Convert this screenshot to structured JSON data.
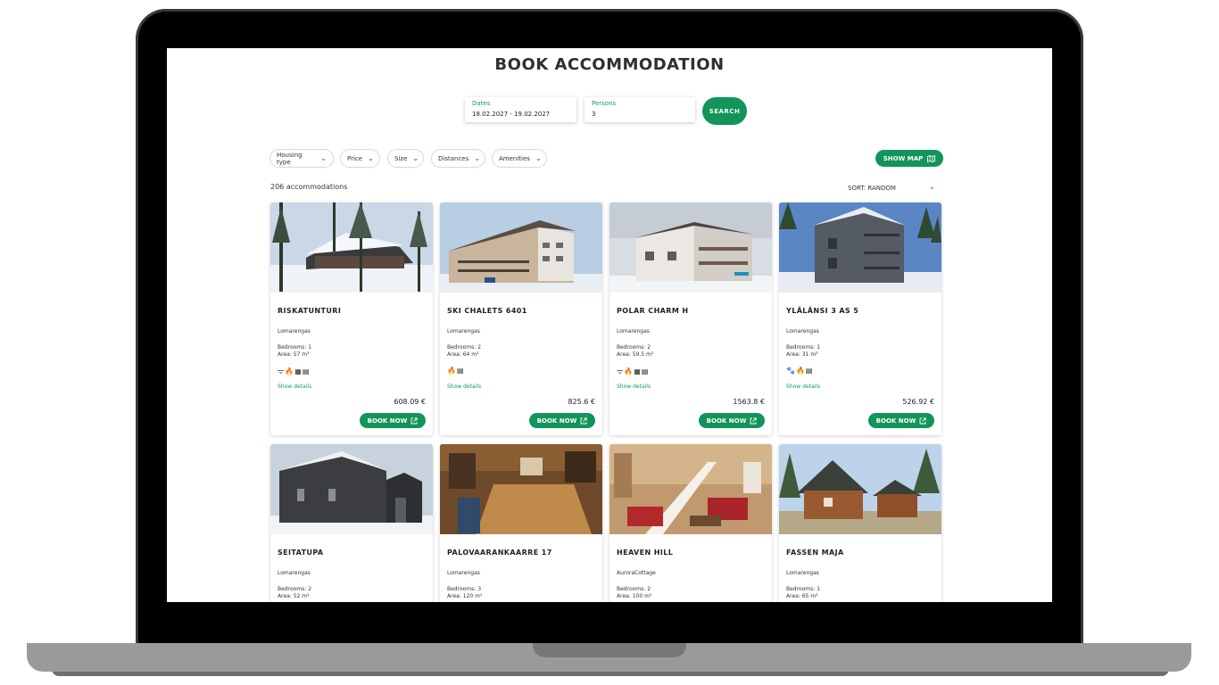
{
  "page": {
    "title": "BOOK ACCOMMODATION"
  },
  "search": {
    "dates_label": "Dates",
    "dates_value": "18.02.2027 - 19.02.2027",
    "persons_label": "Persons",
    "persons_value": "3",
    "search_button": "SEARCH"
  },
  "filters": [
    "Housing type",
    "Price",
    "Size",
    "Distances",
    "Amenities"
  ],
  "map_button": "SHOW MAP",
  "results": {
    "count_text": "206 accommodations",
    "sort_text": "SORT: RANDOM"
  },
  "colors": {
    "accent": "#12945a"
  },
  "cards": [
    {
      "name": "RISKATUNTURI",
      "location": "Lomarengas",
      "bedrooms": "Bedrooms: 1",
      "area": "Area: 57 m²",
      "amenities": "ᯤ🔥▦▤",
      "details": "Show details",
      "price": "608.09 €",
      "book": "BOOK NOW",
      "image": "snowy-cabin-forest"
    },
    {
      "name": "SKI CHALETS 6401",
      "location": "Lomarengas",
      "bedrooms": "Bedrooms: 2",
      "area": "Area: 64 m²",
      "amenities": "🔥▤",
      "details": "Show details",
      "price": "825.6 €",
      "book": "BOOK NOW",
      "image": "apartment-building-winter"
    },
    {
      "name": "POLAR CHARM H",
      "location": "Lomarengas",
      "bedrooms": "Bedrooms: 2",
      "area": "Area: 59.5 m²",
      "amenities": "ᯤ🔥▦▤",
      "details": "Show details",
      "price": "1563.8 €",
      "book": "BOOK NOW",
      "image": "balcony-building-snow"
    },
    {
      "name": "YLÄLÄNSI 3 AS 5",
      "location": "Lomarengas",
      "bedrooms": "Bedrooms: 1",
      "area": "Area: 31 m²",
      "amenities": "🐾🔥▤",
      "details": "Show details",
      "price": "526.92 €",
      "book": "BOOK NOW",
      "image": "grey-house-pines"
    },
    {
      "name": "SEITATUPA",
      "location": "Lomarengas",
      "bedrooms": "Bedrooms: 2",
      "area": "Area: 52 m²",
      "image": "dark-cottage-snow"
    },
    {
      "name": "PALOVAARANKAARRE 17",
      "location": "Lomarengas",
      "bedrooms": "Bedrooms: 3",
      "area": "Area: 120 m²",
      "image": "log-dining-room"
    },
    {
      "name": "HEAVEN HILL",
      "location": "AuroraCottage",
      "bedrooms": "Bedrooms: 2",
      "area": "Area: 100 m²",
      "image": "living-room-stairs"
    },
    {
      "name": "FASSEN MAJA",
      "location": "Lomarengas",
      "bedrooms": "Bedrooms: 1",
      "area": "Area: 65 m²",
      "image": "log-cabin-summer"
    }
  ]
}
